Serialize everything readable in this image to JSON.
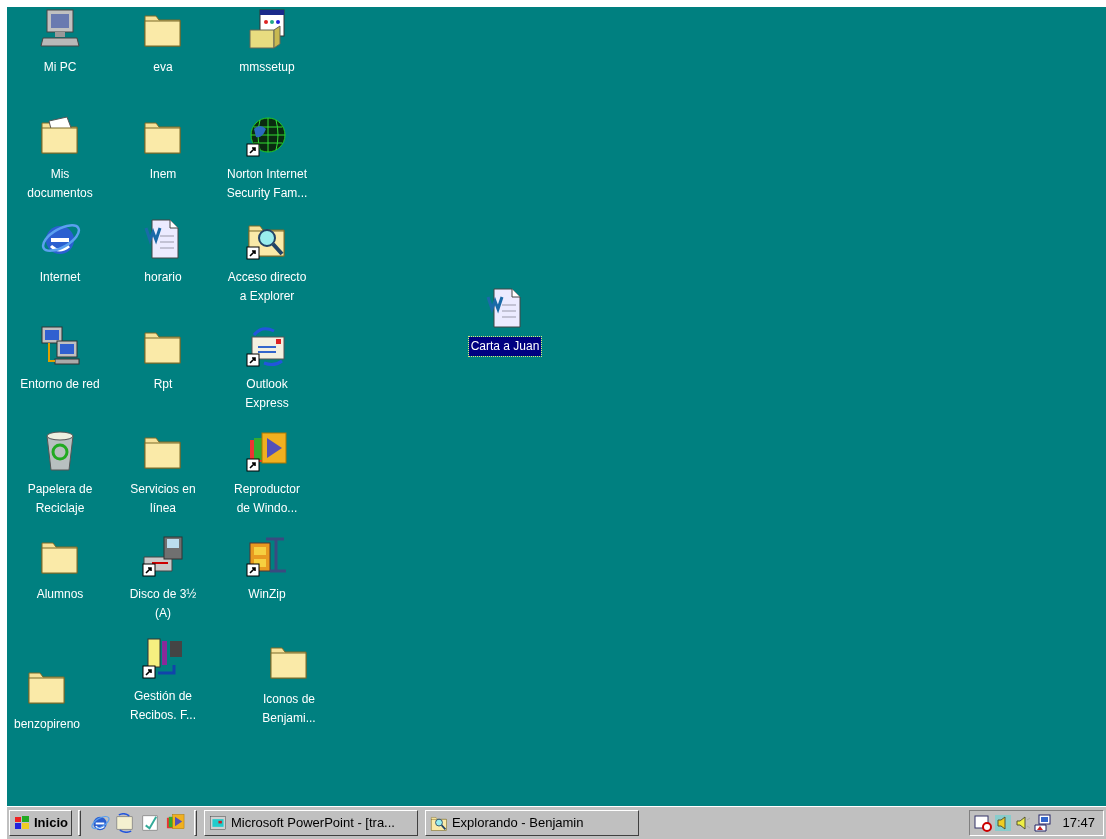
{
  "desktop": {
    "icons": [
      {
        "kind": "computer",
        "label_lines": [
          "Mi PC"
        ],
        "shortcut": false,
        "selected": false
      },
      {
        "kind": "folder",
        "label_lines": [
          "eva"
        ],
        "shortcut": false,
        "selected": false
      },
      {
        "kind": "installer",
        "label_lines": [
          "mmssetup"
        ],
        "shortcut": false,
        "selected": false
      },
      {
        "kind": "documents",
        "label_lines": [
          "Mis",
          "documentos"
        ],
        "shortcut": false,
        "selected": false
      },
      {
        "kind": "folder",
        "label_lines": [
          "Inem"
        ],
        "shortcut": false,
        "selected": false
      },
      {
        "kind": "globe",
        "label_lines": [
          "Norton Internet",
          "Security Fam..."
        ],
        "shortcut": true,
        "selected": false
      },
      {
        "kind": "browser",
        "label_lines": [
          "Internet"
        ],
        "shortcut": false,
        "selected": false
      },
      {
        "kind": "document",
        "label_lines": [
          "horario"
        ],
        "shortcut": false,
        "selected": false
      },
      {
        "kind": "explorer",
        "label_lines": [
          "Acceso directo",
          "a Explorer"
        ],
        "shortcut": true,
        "selected": false
      },
      {
        "kind": "document",
        "label_lines": [
          "Carta a Juan"
        ],
        "shortcut": false,
        "selected": true
      },
      {
        "kind": "network",
        "label_lines": [
          "Entorno de red"
        ],
        "shortcut": false,
        "selected": false
      },
      {
        "kind": "folder",
        "label_lines": [
          "Rpt"
        ],
        "shortcut": false,
        "selected": false
      },
      {
        "kind": "mail",
        "label_lines": [
          "Outlook",
          "Express"
        ],
        "shortcut": true,
        "selected": false
      },
      {
        "kind": "recycle",
        "label_lines": [
          "Papelera de",
          "Reciclaje"
        ],
        "shortcut": false,
        "selected": false
      },
      {
        "kind": "folder",
        "label_lines": [
          "Servicios en",
          "línea"
        ],
        "shortcut": false,
        "selected": false
      },
      {
        "kind": "media",
        "label_lines": [
          "Reproductor",
          "de Windo..."
        ],
        "shortcut": true,
        "selected": false
      },
      {
        "kind": "folder",
        "label_lines": [
          "Alumnos"
        ],
        "shortcut": false,
        "selected": false
      },
      {
        "kind": "floppy",
        "label_lines": [
          "Disco de 3½",
          "(A)"
        ],
        "shortcut": true,
        "selected": false
      },
      {
        "kind": "archive",
        "label_lines": [
          "WinZip"
        ],
        "shortcut": true,
        "selected": false
      },
      {
        "kind": "folder",
        "label_lines": [
          "benzopireno"
        ],
        "shortcut": false,
        "selected": false
      },
      {
        "kind": "app",
        "label_lines": [
          "Gestión de",
          "Recibos. F..."
        ],
        "shortcut": true,
        "selected": false
      },
      {
        "kind": "folder",
        "label_lines": [
          "Iconos de",
          "Benjami..."
        ],
        "shortcut": false,
        "selected": false
      }
    ]
  },
  "taskbar": {
    "start_button": {
      "label": "Inicio"
    },
    "quick_launch": [
      {
        "kind": "browser"
      },
      {
        "kind": "desktop"
      },
      {
        "kind": "channels"
      },
      {
        "kind": "media"
      }
    ],
    "tasks": [
      {
        "kind": "presentation",
        "label": "Microsoft PowerPoint - [tra...",
        "selected": false
      },
      {
        "kind": "explorer",
        "label": "Explorando - Benjamin",
        "selected": false
      }
    ],
    "tray": {
      "clock": "17:47"
    }
  }
}
